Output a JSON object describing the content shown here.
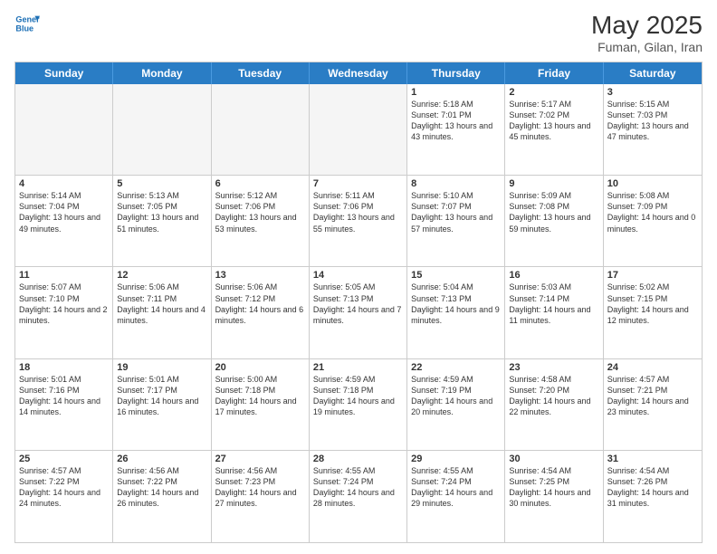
{
  "header": {
    "logo_line1": "General",
    "logo_line2": "Blue",
    "month_year": "May 2025",
    "location": "Fuman, Gilan, Iran"
  },
  "weekdays": [
    "Sunday",
    "Monday",
    "Tuesday",
    "Wednesday",
    "Thursday",
    "Friday",
    "Saturday"
  ],
  "weeks": [
    [
      {
        "day": "",
        "text": "",
        "empty": true
      },
      {
        "day": "",
        "text": "",
        "empty": true
      },
      {
        "day": "",
        "text": "",
        "empty": true
      },
      {
        "day": "",
        "text": "",
        "empty": true
      },
      {
        "day": "1",
        "text": "Sunrise: 5:18 AM\nSunset: 7:01 PM\nDaylight: 13 hours\nand 43 minutes."
      },
      {
        "day": "2",
        "text": "Sunrise: 5:17 AM\nSunset: 7:02 PM\nDaylight: 13 hours\nand 45 minutes."
      },
      {
        "day": "3",
        "text": "Sunrise: 5:15 AM\nSunset: 7:03 PM\nDaylight: 13 hours\nand 47 minutes."
      }
    ],
    [
      {
        "day": "4",
        "text": "Sunrise: 5:14 AM\nSunset: 7:04 PM\nDaylight: 13 hours\nand 49 minutes."
      },
      {
        "day": "5",
        "text": "Sunrise: 5:13 AM\nSunset: 7:05 PM\nDaylight: 13 hours\nand 51 minutes."
      },
      {
        "day": "6",
        "text": "Sunrise: 5:12 AM\nSunset: 7:06 PM\nDaylight: 13 hours\nand 53 minutes."
      },
      {
        "day": "7",
        "text": "Sunrise: 5:11 AM\nSunset: 7:06 PM\nDaylight: 13 hours\nand 55 minutes."
      },
      {
        "day": "8",
        "text": "Sunrise: 5:10 AM\nSunset: 7:07 PM\nDaylight: 13 hours\nand 57 minutes."
      },
      {
        "day": "9",
        "text": "Sunrise: 5:09 AM\nSunset: 7:08 PM\nDaylight: 13 hours\nand 59 minutes."
      },
      {
        "day": "10",
        "text": "Sunrise: 5:08 AM\nSunset: 7:09 PM\nDaylight: 14 hours\nand 0 minutes."
      }
    ],
    [
      {
        "day": "11",
        "text": "Sunrise: 5:07 AM\nSunset: 7:10 PM\nDaylight: 14 hours\nand 2 minutes."
      },
      {
        "day": "12",
        "text": "Sunrise: 5:06 AM\nSunset: 7:11 PM\nDaylight: 14 hours\nand 4 minutes."
      },
      {
        "day": "13",
        "text": "Sunrise: 5:06 AM\nSunset: 7:12 PM\nDaylight: 14 hours\nand 6 minutes."
      },
      {
        "day": "14",
        "text": "Sunrise: 5:05 AM\nSunset: 7:13 PM\nDaylight: 14 hours\nand 7 minutes."
      },
      {
        "day": "15",
        "text": "Sunrise: 5:04 AM\nSunset: 7:13 PM\nDaylight: 14 hours\nand 9 minutes."
      },
      {
        "day": "16",
        "text": "Sunrise: 5:03 AM\nSunset: 7:14 PM\nDaylight: 14 hours\nand 11 minutes."
      },
      {
        "day": "17",
        "text": "Sunrise: 5:02 AM\nSunset: 7:15 PM\nDaylight: 14 hours\nand 12 minutes."
      }
    ],
    [
      {
        "day": "18",
        "text": "Sunrise: 5:01 AM\nSunset: 7:16 PM\nDaylight: 14 hours\nand 14 minutes."
      },
      {
        "day": "19",
        "text": "Sunrise: 5:01 AM\nSunset: 7:17 PM\nDaylight: 14 hours\nand 16 minutes."
      },
      {
        "day": "20",
        "text": "Sunrise: 5:00 AM\nSunset: 7:18 PM\nDaylight: 14 hours\nand 17 minutes."
      },
      {
        "day": "21",
        "text": "Sunrise: 4:59 AM\nSunset: 7:18 PM\nDaylight: 14 hours\nand 19 minutes."
      },
      {
        "day": "22",
        "text": "Sunrise: 4:59 AM\nSunset: 7:19 PM\nDaylight: 14 hours\nand 20 minutes."
      },
      {
        "day": "23",
        "text": "Sunrise: 4:58 AM\nSunset: 7:20 PM\nDaylight: 14 hours\nand 22 minutes."
      },
      {
        "day": "24",
        "text": "Sunrise: 4:57 AM\nSunset: 7:21 PM\nDaylight: 14 hours\nand 23 minutes."
      }
    ],
    [
      {
        "day": "25",
        "text": "Sunrise: 4:57 AM\nSunset: 7:22 PM\nDaylight: 14 hours\nand 24 minutes."
      },
      {
        "day": "26",
        "text": "Sunrise: 4:56 AM\nSunset: 7:22 PM\nDaylight: 14 hours\nand 26 minutes."
      },
      {
        "day": "27",
        "text": "Sunrise: 4:56 AM\nSunset: 7:23 PM\nDaylight: 14 hours\nand 27 minutes."
      },
      {
        "day": "28",
        "text": "Sunrise: 4:55 AM\nSunset: 7:24 PM\nDaylight: 14 hours\nand 28 minutes."
      },
      {
        "day": "29",
        "text": "Sunrise: 4:55 AM\nSunset: 7:24 PM\nDaylight: 14 hours\nand 29 minutes."
      },
      {
        "day": "30",
        "text": "Sunrise: 4:54 AM\nSunset: 7:25 PM\nDaylight: 14 hours\nand 30 minutes."
      },
      {
        "day": "31",
        "text": "Sunrise: 4:54 AM\nSunset: 7:26 PM\nDaylight: 14 hours\nand 31 minutes."
      }
    ]
  ]
}
